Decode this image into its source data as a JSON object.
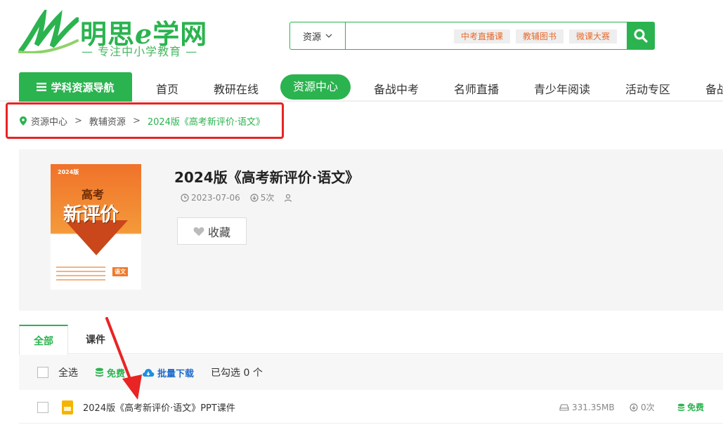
{
  "logo": {
    "title_a": "明思",
    "title_e": "e",
    "title_b": "学网",
    "subtitle": "— 专注中小学教育 —"
  },
  "search": {
    "category": "资源",
    "placeholder": "",
    "tags": [
      "中考直播课",
      "教辅图书",
      "微课大赛"
    ]
  },
  "nav": {
    "guide": "学科资源导航",
    "items": [
      "首页",
      "教研在线",
      "资源中心",
      "备战中考",
      "名师直播",
      "青少年阅读",
      "活动专区",
      "备战"
    ]
  },
  "breadcrumb": {
    "items": [
      "资源中心",
      "教辅资源"
    ],
    "current": "2024版《高考新评价·语文》"
  },
  "resource": {
    "title": "2024版《高考新评价·语文》",
    "date": "2023-07-06",
    "downloads": "5次",
    "favorite": "收藏",
    "cover": {
      "year": "2024版",
      "line1": "高考",
      "line2": "新评价",
      "subject": "语文"
    }
  },
  "tabs": [
    "全部",
    "课件"
  ],
  "toolbar": {
    "select_all": "全选",
    "free": "免费",
    "batch": "批量下载",
    "selected": "已勾选 0 个"
  },
  "files": [
    {
      "name": "2024版《高考新评价·语文》PPT课件",
      "size": "331.35MB",
      "downloads": "0次",
      "price": "免费"
    }
  ],
  "colors": {
    "brand": "#2bb34f",
    "highlight_box": "#e82424",
    "tag_text": "#e96a2b",
    "batch": "#1e6ccc"
  }
}
